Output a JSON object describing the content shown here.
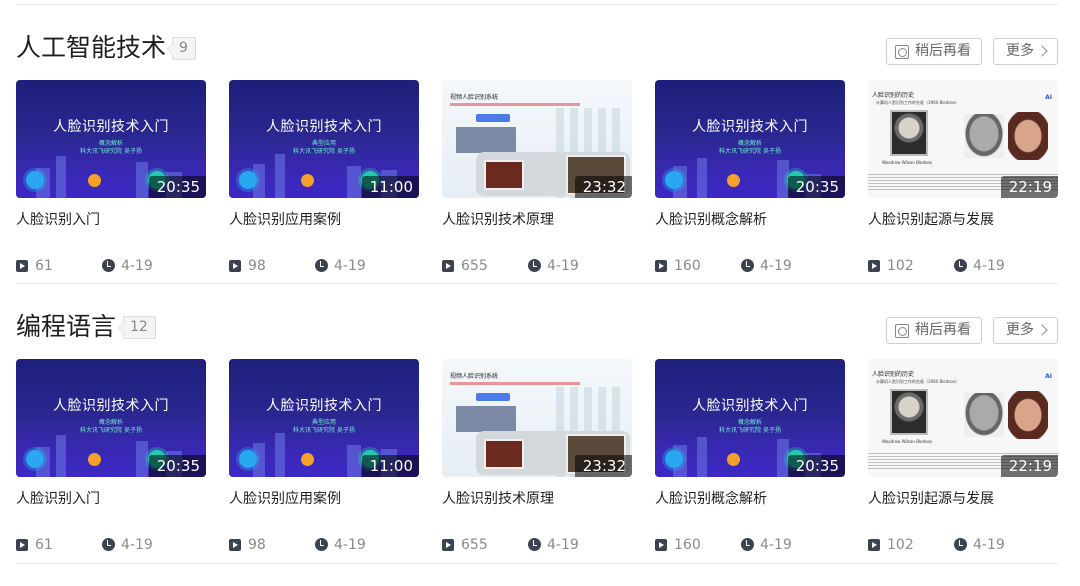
{
  "sections": [
    {
      "title": "人工智能技术",
      "count": "9",
      "watch_later_label": "稍后再看",
      "more_label": "更多",
      "videos": [
        {
          "thumb_title": "人脸识别技术入门",
          "thumb_sub1": "概念解析",
          "thumb_sub2": "科大讯飞研究院 吴子扬",
          "duration": "20:35",
          "title": "人脸识别入门",
          "views": "61",
          "date": "4-19"
        },
        {
          "thumb_title": "人脸识别技术入门",
          "thumb_sub1": "典型应用",
          "thumb_sub2": "科大讯飞研究院 吴子扬",
          "duration": "11:00",
          "title": "人脸识别应用案例",
          "views": "98",
          "date": "4-19"
        },
        {
          "thumb_title": "视频人脸识别系统",
          "duration": "23:32",
          "title": "人脸识别技术原理",
          "views": "655",
          "date": "4-19"
        },
        {
          "thumb_title": "人脸识别技术入门",
          "thumb_sub1": "概念解析",
          "thumb_sub2": "科大讯飞研究院 吴子扬",
          "duration": "20:35",
          "title": "人脸识别概念解析",
          "views": "160",
          "date": "4-19"
        },
        {
          "thumb_title": "人脸识别的历史",
          "thumb_sub1": "计算机人脸识别工作的先驱（1960 Bledsoe）",
          "thumb_caption": "Woodrow Wilson Bledsoe",
          "duration": "22:19",
          "title": "人脸识别起源与发展",
          "views": "102",
          "date": "4-19"
        }
      ]
    },
    {
      "title": "编程语言",
      "count": "12",
      "watch_later_label": "稍后再看",
      "more_label": "更多",
      "videos": [
        {
          "thumb_title": "人脸识别技术入门",
          "thumb_sub1": "概念解析",
          "thumb_sub2": "科大讯飞研究院 吴子扬",
          "duration": "20:35",
          "title": "人脸识别入门",
          "views": "61",
          "date": "4-19"
        },
        {
          "thumb_title": "人脸识别技术入门",
          "thumb_sub1": "典型应用",
          "thumb_sub2": "科大讯飞研究院 吴子扬",
          "duration": "11:00",
          "title": "人脸识别应用案例",
          "views": "98",
          "date": "4-19"
        },
        {
          "thumb_title": "视频人脸识别系统",
          "duration": "23:32",
          "title": "人脸识别技术原理",
          "views": "655",
          "date": "4-19"
        },
        {
          "thumb_title": "人脸识别技术入门",
          "thumb_sub1": "概念解析",
          "thumb_sub2": "科大讯飞研究院 吴子扬",
          "duration": "20:35",
          "title": "人脸识别概念解析",
          "views": "160",
          "date": "4-19"
        },
        {
          "thumb_title": "人脸识别的历史",
          "thumb_sub1": "计算机人脸识别工作的先驱（1960 Bledsoe）",
          "thumb_caption": "Woodrow Wilson Bledsoe",
          "duration": "22:19",
          "title": "人脸识别起源与发展",
          "views": "102",
          "date": "4-19"
        }
      ]
    }
  ],
  "icons": {
    "watch_later": "clock-box-icon",
    "more": "chevron-right-icon",
    "views": "play-icon",
    "date": "clock-icon"
  },
  "colors": {
    "accent_dark_thumb": "#2a2790",
    "meta_icon": "#3c4350",
    "text_muted": "#8a8a8a"
  }
}
